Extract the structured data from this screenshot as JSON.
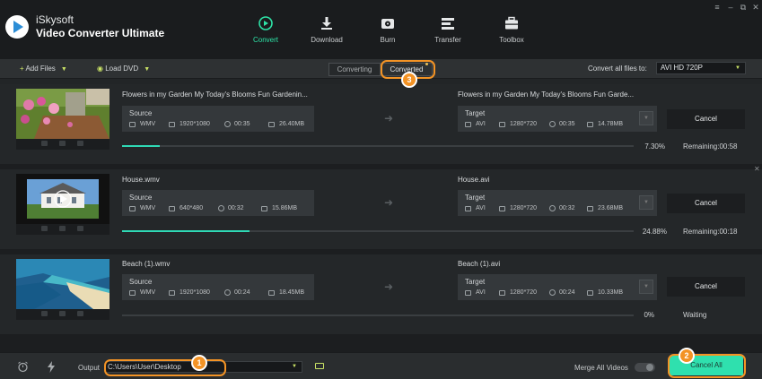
{
  "app": {
    "brand_line1": "iSkysoft",
    "brand_line2": "Video Converter Ultimate"
  },
  "nav": [
    {
      "label": "Convert",
      "icon": "convert-icon",
      "active": true
    },
    {
      "label": "Download",
      "icon": "download-icon"
    },
    {
      "label": "Burn",
      "icon": "burn-icon"
    },
    {
      "label": "Transfer",
      "icon": "transfer-icon"
    },
    {
      "label": "Toolbox",
      "icon": "toolbox-icon"
    }
  ],
  "window_controls": {
    "menu": "≡",
    "minimize": "–",
    "maximize": "⧉",
    "close": "✕"
  },
  "toolbar": {
    "add_files": "Add Files",
    "load_dvd": "Load DVD",
    "tab_converting": "Converting",
    "tab_converted": "Converted",
    "convert_all_label": "Convert all files to:",
    "format_value": "AVI HD 720P"
  },
  "files": [
    {
      "source_name": "Flowers in my Garden  My Today's Blooms  Fun Gardenin...",
      "target_name": "Flowers in my Garden  My Today's Blooms  Fun Garde...",
      "source": {
        "header": "Source",
        "format": "WMV",
        "resolution": "1920*1080",
        "duration": "00:35",
        "size": "26.40MB"
      },
      "target": {
        "header": "Target",
        "format": "AVI",
        "resolution": "1280*720",
        "duration": "00:35",
        "size": "14.78MB"
      },
      "progress_pct": 7.3,
      "progress_text": "7.30%",
      "status": "Remaining:00:58",
      "cancel": "Cancel"
    },
    {
      "source_name": "House.wmv",
      "target_name": "House.avi",
      "source": {
        "header": "Source",
        "format": "WMV",
        "resolution": "640*480",
        "duration": "00:32",
        "size": "15.86MB"
      },
      "target": {
        "header": "Target",
        "format": "AVI",
        "resolution": "1280*720",
        "duration": "00:32",
        "size": "23.68MB"
      },
      "progress_pct": 24.88,
      "progress_text": "24.88%",
      "status": "Remaining:00:18",
      "cancel": "Cancel"
    },
    {
      "source_name": "Beach (1).wmv",
      "target_name": "Beach (1).avi",
      "source": {
        "header": "Source",
        "format": "WMV",
        "resolution": "1920*1080",
        "duration": "00:24",
        "size": "18.45MB"
      },
      "target": {
        "header": "Target",
        "format": "AVI",
        "resolution": "1280*720",
        "duration": "00:24",
        "size": "10.33MB"
      },
      "progress_pct": 0,
      "progress_text": "0%",
      "status": "Waiting",
      "cancel": "Cancel"
    }
  ],
  "bottom": {
    "output_label": "Output",
    "output_path": "C:\\Users\\User\\Desktop",
    "merge_label": "Merge All Videos",
    "cancel_all": "Cancel All"
  },
  "annotations": [
    "1",
    "2",
    "3"
  ],
  "colors": {
    "accent": "#2fe0ae",
    "highlight": "#f39325",
    "progress": "#2fd9b5"
  }
}
